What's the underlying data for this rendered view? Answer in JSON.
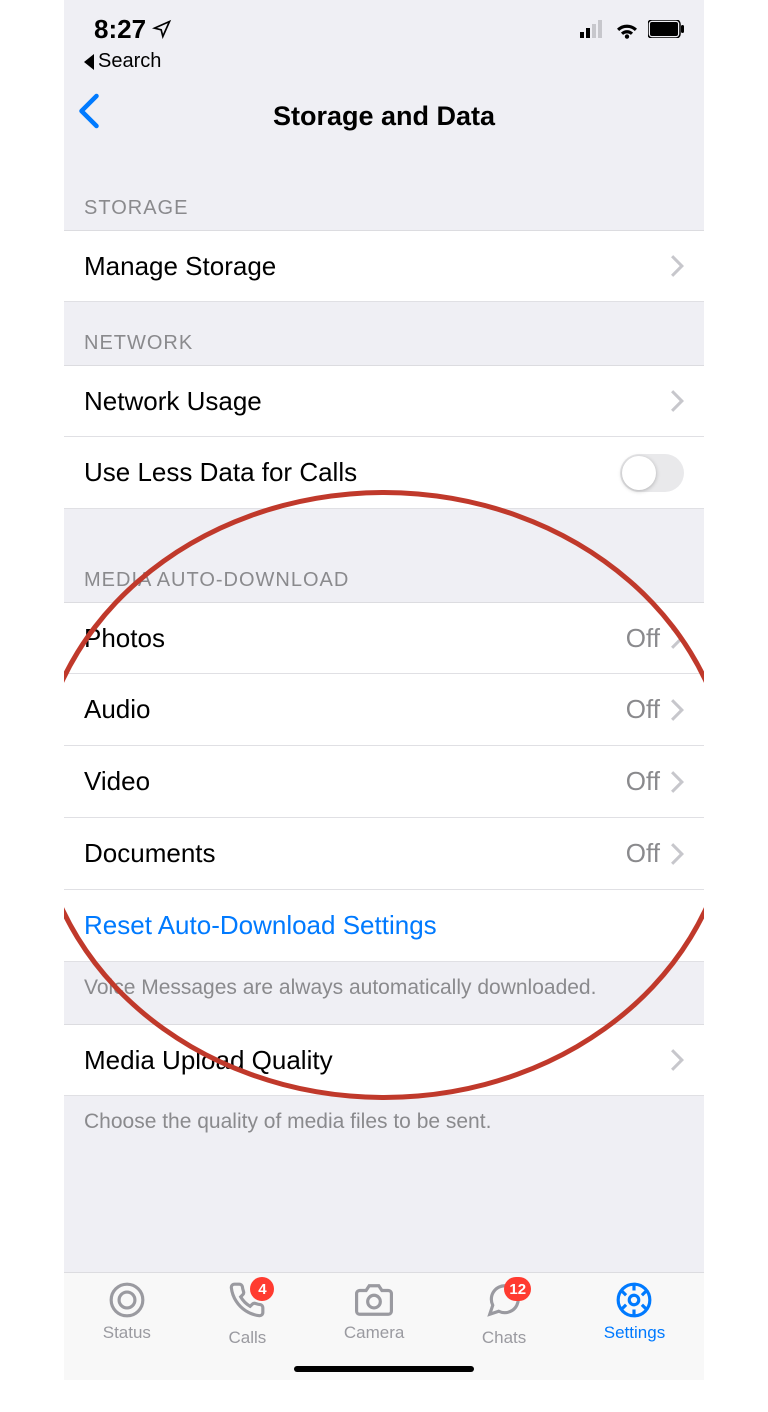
{
  "status": {
    "time": "8:27",
    "back_crumb": "Search"
  },
  "nav": {
    "title": "Storage and Data"
  },
  "sections": {
    "storage": {
      "header": "STORAGE",
      "manage": "Manage Storage"
    },
    "network": {
      "header": "NETWORK",
      "usage": "Network Usage",
      "less_data": "Use Less Data for Calls",
      "less_data_on": false
    },
    "media": {
      "header": "MEDIA AUTO-DOWNLOAD",
      "photos": {
        "label": "Photos",
        "value": "Off"
      },
      "audio": {
        "label": "Audio",
        "value": "Off"
      },
      "video": {
        "label": "Video",
        "value": "Off"
      },
      "documents": {
        "label": "Documents",
        "value": "Off"
      },
      "reset": "Reset Auto-Download Settings",
      "footer": "Voice Messages are always automatically downloaded."
    },
    "upload": {
      "label": "Media Upload Quality",
      "footer": "Choose the quality of media files to be sent."
    }
  },
  "tabs": {
    "status": "Status",
    "calls": "Calls",
    "calls_badge": "4",
    "camera": "Camera",
    "chats": "Chats",
    "chats_badge": "12",
    "settings": "Settings"
  }
}
